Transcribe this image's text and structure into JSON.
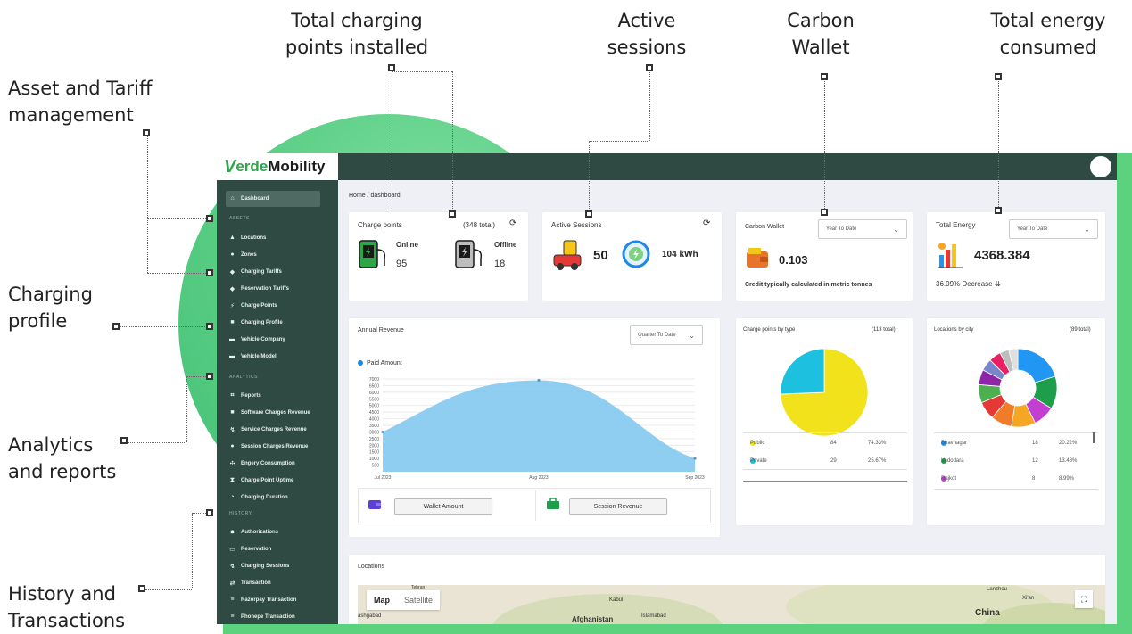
{
  "annotations": {
    "charging_points": [
      "Total charging",
      "points installed"
    ],
    "active_sessions": [
      "Active",
      "sessions"
    ],
    "carbon_wallet": [
      "Carbon",
      "Wallet"
    ],
    "total_energy": [
      "Total energy",
      "consumed"
    ],
    "asset_tariff": [
      "Asset and Tariff",
      "management"
    ],
    "charging_profile": [
      "Charging",
      "profile"
    ],
    "analytics": [
      "Analytics",
      "and reports"
    ],
    "history": [
      "History and",
      "Transactions"
    ]
  },
  "brand": {
    "v": "V",
    "verde": "erde",
    "mobility": "Mobility",
    "green": "#2fa54a",
    "dark": "#2e4a42"
  },
  "sidebar": {
    "dashboard": "Dashboard",
    "assets_head": "ASSETS",
    "assets": [
      "Locations",
      "Zones",
      "Charging Tariffs",
      "Reservation Tariffs",
      "Charge Points",
      "Charging Profile",
      "Vehicle Company",
      "Vehicle Model"
    ],
    "analytics_head": "ANALYTICS",
    "analytics": [
      "Reports",
      "Software Charges Revenue",
      "Service Charges Revenue",
      "Session Charges Revenue",
      "Engery Consumption",
      "Charge Point Uptime",
      "Charging Duration"
    ],
    "history_head": "HISTORY",
    "history": [
      "Authorizations",
      "Reservation",
      "Charging Sessions",
      "Transaction",
      "Razorpay Transaction",
      "Phonepe Transaction"
    ]
  },
  "breadcrumb": "Home  /  dashboard",
  "charge_points": {
    "title": "Charge points",
    "total": "(348 total)",
    "online_label": "Online",
    "online_value": "95",
    "offline_label": "Offline",
    "offline_value": "18"
  },
  "active_sessions": {
    "title": "Active Sessions",
    "count": "50",
    "energy": "104 kWh"
  },
  "carbon_wallet": {
    "title": "Carbon Wallet",
    "dropdown": "Year To Date",
    "value": "0.103",
    "note": "Credit typically calculated in metric tonnes"
  },
  "total_energy": {
    "title": "Total Energy",
    "dropdown": "Year To Date",
    "value": "4368.384",
    "change": "36.09% Decrease"
  },
  "annual_revenue": {
    "title": "Annual Revenue",
    "dropdown": "Quarter To Date",
    "legend": "Paid Amount",
    "wallet_button": "Wallet Amount",
    "session_button": "Session Revenue"
  },
  "cp_by_type": {
    "title": "Charge points by type",
    "total": "(113 total)",
    "rows": [
      {
        "label": "Public",
        "count": "84",
        "pct": "74.33%",
        "color": "#f2e21b"
      },
      {
        "label": "Private",
        "count": "29",
        "pct": "25.67%",
        "color": "#1ec0e0"
      }
    ]
  },
  "locations_by_city": {
    "title": "Locations by city",
    "total": "(89 total)",
    "rows": [
      {
        "label": "Bhavnagar",
        "count": "18",
        "pct": "20.22%",
        "color": "#2196f3"
      },
      {
        "label": "Vadodara",
        "count": "12",
        "pct": "13.48%",
        "color": "#1e9e4a"
      },
      {
        "label": "Rajkot",
        "count": "8",
        "pct": "8.99%",
        "color": "#c23fd1"
      }
    ]
  },
  "locations_map": {
    "title": "Locations",
    "tab_map": "Map",
    "tab_satellite": "Satellite",
    "labels": [
      "Afghanistan",
      "Kabul",
      "Islamabad",
      "China",
      "Lanzhou",
      "Xi'an",
      "ashgabad",
      "Tehran"
    ]
  },
  "chart_data": [
    {
      "type": "area",
      "x": [
        "Jul 2023",
        "Aug 2023",
        "Sep 2023"
      ],
      "series": [
        {
          "name": "Paid Amount",
          "values": [
            3000,
            6900,
            1000
          ]
        }
      ],
      "yticks": [
        500,
        1000,
        1500,
        2000,
        2500,
        3000,
        3500,
        4000,
        4500,
        5000,
        5500,
        6000,
        6500,
        7000
      ],
      "ylim": [
        0,
        7000
      ],
      "color": "#84c9f0"
    },
    {
      "type": "pie",
      "categories": [
        "Public",
        "Private"
      ],
      "values": [
        84,
        29
      ],
      "colors": [
        "#f2e21b",
        "#1ec0e0"
      ]
    },
    {
      "type": "pie",
      "categories": [
        "Bhavnagar",
        "Vadodara",
        "Rajkot"
      ],
      "values": [
        20.22,
        13.48,
        8.99
      ],
      "colors": [
        "#2196f3",
        "#1e9e4a",
        "#c23fd1",
        "#f5a623",
        "#f07c2a",
        "#e53935",
        "#4caf50",
        "#8e24aa",
        "#7986cb",
        "#e91e63",
        "#bdbdbd",
        "#e0e0e0"
      ],
      "donut": true
    }
  ]
}
